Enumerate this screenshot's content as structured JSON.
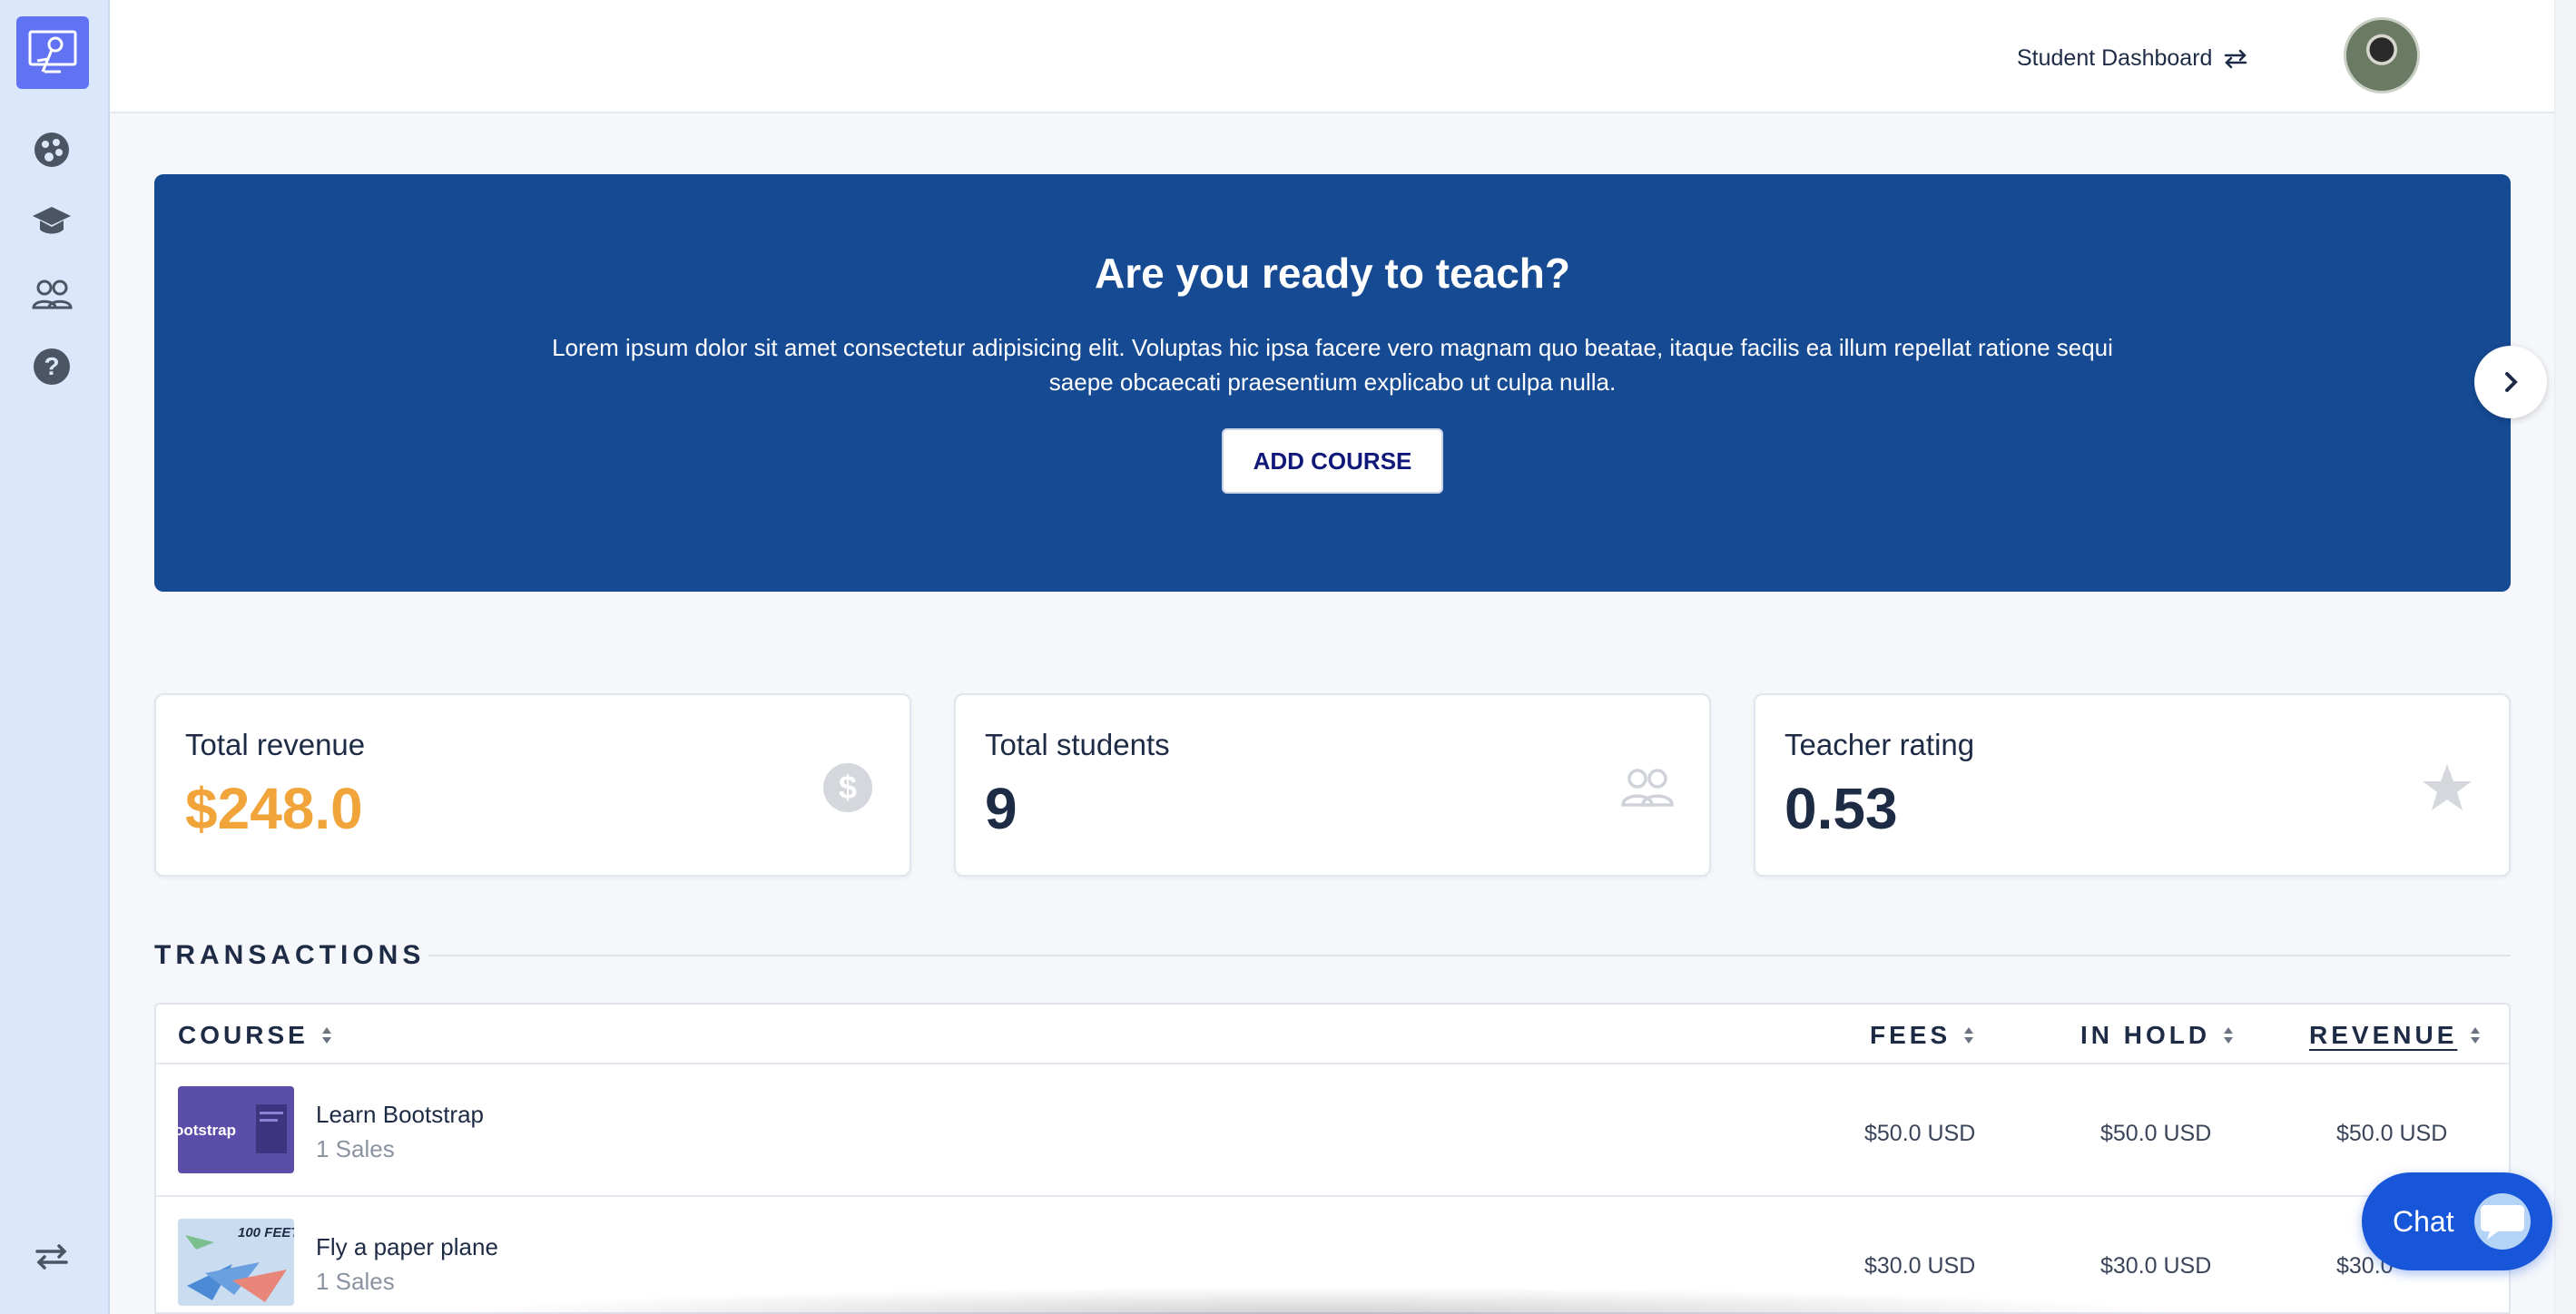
{
  "header": {
    "switch_label": "Student Dashboard",
    "switch_icon": "swap-arrows-icon"
  },
  "sidebar": {
    "items": [
      {
        "icon": "palette-icon"
      },
      {
        "icon": "graduation-cap-icon"
      },
      {
        "icon": "users-icon"
      },
      {
        "icon": "help-icon"
      }
    ],
    "bottom_icon": "swap-arrows-icon"
  },
  "hero": {
    "title": "Are you ready to teach?",
    "text": "Lorem ipsum dolor sit amet consectetur adipisicing elit. Voluptas hic ipsa facere vero magnam quo beatae, itaque facilis ea illum repellat ratione sequi saepe obcaecati praesentium explicabo ut culpa nulla.",
    "button": "ADD COURSE"
  },
  "stats": [
    {
      "label": "Total revenue",
      "value": "$248.0",
      "color": "#f0a43a",
      "icon": "dollar-icon"
    },
    {
      "label": "Total students",
      "value": "9",
      "color": "#1e2b45",
      "icon": "users-icon"
    },
    {
      "label": "Teacher rating",
      "value": "0.53",
      "color": "#1e2b45",
      "icon": "star-icon"
    }
  ],
  "transactions": {
    "title": "TRANSACTIONS",
    "columns": [
      "COURSE",
      "FEES",
      "IN HOLD",
      "REVENUE"
    ],
    "rows": [
      {
        "course": "Learn Bootstrap",
        "sales": "1 Sales",
        "fees": "$50.0 USD",
        "in_hold": "$50.0 USD",
        "revenue": "$50.0 USD",
        "thumb_text": "ootstrap"
      },
      {
        "course": "Fly a paper plane",
        "sales": "1 Sales",
        "fees": "$30.0 USD",
        "in_hold": "$30.0 USD",
        "revenue": "$30.0",
        "thumb_text": "100 FEET!"
      }
    ]
  },
  "chat": {
    "label": "Chat"
  },
  "colors": {
    "accent": "#164a93",
    "sidebar": "#dbe8fb",
    "revenue": "#f0a43a",
    "chat": "#1756d8"
  }
}
